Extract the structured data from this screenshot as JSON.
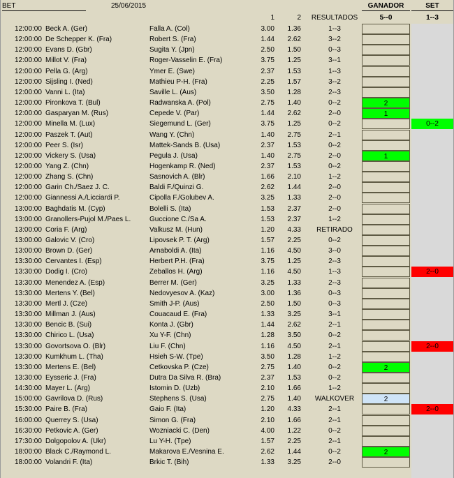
{
  "header": {
    "bet": "BET",
    "date": "25/06/2015",
    "ganador": "GANADOR",
    "set": "SET",
    "col1": "1",
    "col2": "2",
    "resultados": "RESULTADOS",
    "ganador_score": "5--0",
    "set_score": "1--3"
  },
  "colors": {
    "win": "#00ff00",
    "loss": "#ff0000",
    "walkover": "#cfe4f7",
    "sheet": "#ddd9c4",
    "set_column": "#d9d9d9"
  },
  "rows": [
    {
      "time": "12:00:00",
      "p1": "Beck A. (Ger)",
      "p2": "Falla A. (Col)",
      "o1": "3.00",
      "o2": "1.36",
      "res": "1--3",
      "gan": "",
      "set": ""
    },
    {
      "time": "12:00:00",
      "p1": "De Schepper K. (Fra)",
      "p2": "Robert S. (Fra)",
      "o1": "1.44",
      "o2": "2.62",
      "res": "3--2",
      "gan": "",
      "set": ""
    },
    {
      "time": "12:00:00",
      "p1": "Evans D. (Gbr)",
      "p2": "Sugita Y. (Jpn)",
      "o1": "2.50",
      "o2": "1.50",
      "res": "0--3",
      "gan": "",
      "set": ""
    },
    {
      "time": "12:00:00",
      "p1": "Millot V. (Fra)",
      "p2": "Roger-Vasselin E. (Fra)",
      "o1": "3.75",
      "o2": "1.25",
      "res": "3--1",
      "gan": "",
      "set": ""
    },
    {
      "time": "12:00:00",
      "p1": "Pella G. (Arg)",
      "p2": "Ymer E. (Swe)",
      "o1": "2.37",
      "o2": "1.53",
      "res": "1--3",
      "gan": "",
      "set": ""
    },
    {
      "time": "12:00:00",
      "p1": "Sijsling I. (Ned)",
      "p2": "Mathieu P-H. (Fra)",
      "o1": "2.25",
      "o2": "1.57",
      "res": "3--2",
      "gan": "",
      "set": ""
    },
    {
      "time": "12:00:00",
      "p1": "Vanni L. (Ita)",
      "p2": "Saville L. (Aus)",
      "o1": "3.50",
      "o2": "1.28",
      "res": "2--3",
      "gan": "",
      "set": ""
    },
    {
      "time": "12:00:00",
      "p1": "Pironkova T. (Bul)",
      "p2": "Radwanska A. (Pol)",
      "o1": "2.75",
      "o2": "1.40",
      "res": "0--2",
      "gan": "2",
      "gan_color": "green",
      "set": ""
    },
    {
      "time": "12:00:00",
      "p1": "Gasparyan M. (Rus)",
      "p2": "Cepede V. (Par)",
      "o1": "1.44",
      "o2": "2.62",
      "res": "2--0",
      "gan": "1",
      "gan_color": "green",
      "set": ""
    },
    {
      "time": "12:00:00",
      "p1": "Minella M. (Lux)",
      "p2": "Siegemund L. (Ger)",
      "o1": "3.75",
      "o2": "1.25",
      "res": "0--2",
      "gan": "",
      "set": "0--2",
      "set_color": "green"
    },
    {
      "time": "12:00:00",
      "p1": "Paszek T. (Aut)",
      "p2": "Wang Y. (Chn)",
      "o1": "1.40",
      "o2": "2.75",
      "res": "2--1",
      "gan": "",
      "set": ""
    },
    {
      "time": "12:00:00",
      "p1": "Peer S. (Isr)",
      "p2": "Mattek-Sands B. (Usa)",
      "o1": "2.37",
      "o2": "1.53",
      "res": "0--2",
      "gan": "",
      "set": ""
    },
    {
      "time": "12:00:00",
      "p1": "Vickery S. (Usa)",
      "p2": "Pegula J. (Usa)",
      "o1": "1.40",
      "o2": "2.75",
      "res": "2--0",
      "gan": "1",
      "gan_color": "green",
      "set": ""
    },
    {
      "time": "12:00:00",
      "p1": "Yang Z. (Chn)",
      "p2": "Hogenkamp R. (Ned)",
      "o1": "2.37",
      "o2": "1.53",
      "res": "0--2",
      "gan": "",
      "set": ""
    },
    {
      "time": "12:00:00",
      "p1": "Zhang S. (Chn)",
      "p2": "Sasnovich A. (Blr)",
      "o1": "1.66",
      "o2": "2.10",
      "res": "1--2",
      "gan": "",
      "set": ""
    },
    {
      "time": "12:00:00",
      "p1": "Garin Ch./Saez J. C.",
      "p2": "Baldi F./Quinzi G.",
      "o1": "2.62",
      "o2": "1.44",
      "res": "2--0",
      "gan": "",
      "set": ""
    },
    {
      "time": "12:00:00",
      "p1": "Giannessi A./Licciardi P.",
      "p2": "Cipolla F./Golubev A.",
      "o1": "3.25",
      "o2": "1.33",
      "res": "2--0",
      "gan": "",
      "set": ""
    },
    {
      "time": "13:00:00",
      "p1": "Baghdatis M. (Cyp)",
      "p2": "Bolelli S. (Ita)",
      "o1": "1.53",
      "o2": "2.37",
      "res": "2--0",
      "gan": "",
      "set": ""
    },
    {
      "time": "13:00:00",
      "p1": "Granollers-Pujol M./Paes L.",
      "p2": "Guccione C./Sa A.",
      "o1": "1.53",
      "o2": "2.37",
      "res": "1--2",
      "gan": "",
      "set": ""
    },
    {
      "time": "13:00:00",
      "p1": "Coria F. (Arg)",
      "p2": "Valkusz M. (Hun)",
      "o1": "1.20",
      "o2": "4.33",
      "res": "RETIRADO",
      "gan": "",
      "set": ""
    },
    {
      "time": "13:00:00",
      "p1": "Galovic V. (Cro)",
      "p2": "Lipovsek P. T. (Arg)",
      "o1": "1.57",
      "o2": "2.25",
      "res": "0--2",
      "gan": "",
      "set": ""
    },
    {
      "time": "13:00:00",
      "p1": "Brown D. (Ger)",
      "p2": "Arnaboldi A. (Ita)",
      "o1": "1.16",
      "o2": "4.50",
      "res": "3--0",
      "gan": "",
      "set": ""
    },
    {
      "time": "13:30:00",
      "p1": "Cervantes I. (Esp)",
      "p2": "Herbert P.H. (Fra)",
      "o1": "3.75",
      "o2": "1.25",
      "res": "2--3",
      "gan": "",
      "set": ""
    },
    {
      "time": "13:30:00",
      "p1": "Dodig I. (Cro)",
      "p2": "Zeballos H. (Arg)",
      "o1": "1.16",
      "o2": "4.50",
      "res": "1--3",
      "gan": "",
      "set": "2--0",
      "set_color": "red"
    },
    {
      "time": "13:30:00",
      "p1": "Menendez A. (Esp)",
      "p2": "Berrer M. (Ger)",
      "o1": "3.25",
      "o2": "1.33",
      "res": "2--3",
      "gan": "",
      "set": ""
    },
    {
      "time": "13:30:00",
      "p1": "Mertens Y. (Bel)",
      "p2": "Nedovyesov A. (Kaz)",
      "o1": "3.00",
      "o2": "1.36",
      "res": "0--3",
      "gan": "",
      "set": ""
    },
    {
      "time": "13:30:00",
      "p1": "Mertl J. (Cze)",
      "p2": "Smith J-P. (Aus)",
      "o1": "2.50",
      "o2": "1.50",
      "res": "0--3",
      "gan": "",
      "set": ""
    },
    {
      "time": "13:30:00",
      "p1": "Millman J. (Aus)",
      "p2": "Couacaud E. (Fra)",
      "o1": "1.33",
      "o2": "3.25",
      "res": "3--1",
      "gan": "",
      "set": ""
    },
    {
      "time": "13:30:00",
      "p1": "Bencic B. (Sui)",
      "p2": "Konta J. (Gbr)",
      "o1": "1.44",
      "o2": "2.62",
      "res": "2--1",
      "gan": "",
      "set": ""
    },
    {
      "time": "13:30:00",
      "p1": "Chirico L. (Usa)",
      "p2": "Xu Y-F. (Chn)",
      "o1": "1.28",
      "o2": "3.50",
      "res": "0--2",
      "gan": "",
      "set": ""
    },
    {
      "time": "13:30:00",
      "p1": "Govortsova O. (Blr)",
      "p2": "Liu F. (Chn)",
      "o1": "1.16",
      "o2": "4.50",
      "res": "2--1",
      "gan": "",
      "set": "2--0",
      "set_color": "red"
    },
    {
      "time": "13:30:00",
      "p1": "Kumkhum L. (Tha)",
      "p2": "Hsieh S-W. (Tpe)",
      "o1": "3.50",
      "o2": "1.28",
      "res": "1--2",
      "gan": "",
      "set": ""
    },
    {
      "time": "13:30:00",
      "p1": "Mertens E. (Bel)",
      "p2": "Cetkovska P. (Cze)",
      "o1": "2.75",
      "o2": "1.40",
      "res": "0--2",
      "gan": "2",
      "gan_color": "green",
      "set": ""
    },
    {
      "time": "13:30:00",
      "p1": "Eysseric J. (Fra)",
      "p2": "Dutra Da Silva R. (Bra)",
      "o1": "2.37",
      "o2": "1.53",
      "res": "0--2",
      "gan": "",
      "set": ""
    },
    {
      "time": "14:30:00",
      "p1": "Mayer L. (Arg)",
      "p2": "Istomin D. (Uzb)",
      "o1": "2.10",
      "o2": "1.66",
      "res": "1--2",
      "gan": "",
      "set": ""
    },
    {
      "time": "15:00:00",
      "p1": "Gavrilova D. (Rus)",
      "p2": "Stephens S. (Usa)",
      "o1": "2.75",
      "o2": "1.40",
      "res": "WALKOVER",
      "gan": "2",
      "gan_color": "blue",
      "set": ""
    },
    {
      "time": "15:30:00",
      "p1": "Paire B. (Fra)",
      "p2": "Gaio F. (Ita)",
      "o1": "1.20",
      "o2": "4.33",
      "res": "2--1",
      "gan": "",
      "set": "2--0",
      "set_color": "red"
    },
    {
      "time": "16:00:00",
      "p1": "Querrey S. (Usa)",
      "p2": "Simon G. (Fra)",
      "o1": "2.10",
      "o2": "1.66",
      "res": "2--1",
      "gan": "",
      "set": ""
    },
    {
      "time": "16:30:00",
      "p1": "Petkovic A. (Ger)",
      "p2": "Wozniacki C. (Den)",
      "o1": "4.00",
      "o2": "1.22",
      "res": "0--2",
      "gan": "",
      "set": ""
    },
    {
      "time": "17:30:00",
      "p1": "Dolgopolov A. (Ukr)",
      "p2": "Lu Y-H. (Tpe)",
      "o1": "1.57",
      "o2": "2.25",
      "res": "2--1",
      "gan": "",
      "set": ""
    },
    {
      "time": "18:00:00",
      "p1": "Black C./Raymond L.",
      "p2": "Makarova E./Vesnina E.",
      "o1": "2.62",
      "o2": "1.44",
      "res": "0--2",
      "gan": "2",
      "gan_color": "green",
      "set": ""
    },
    {
      "time": "18:00:00",
      "p1": "Volandri F. (Ita)",
      "p2": "Brkic T. (Bih)",
      "o1": "1.33",
      "o2": "3.25",
      "res": "2--0",
      "gan": "",
      "set": ""
    }
  ]
}
